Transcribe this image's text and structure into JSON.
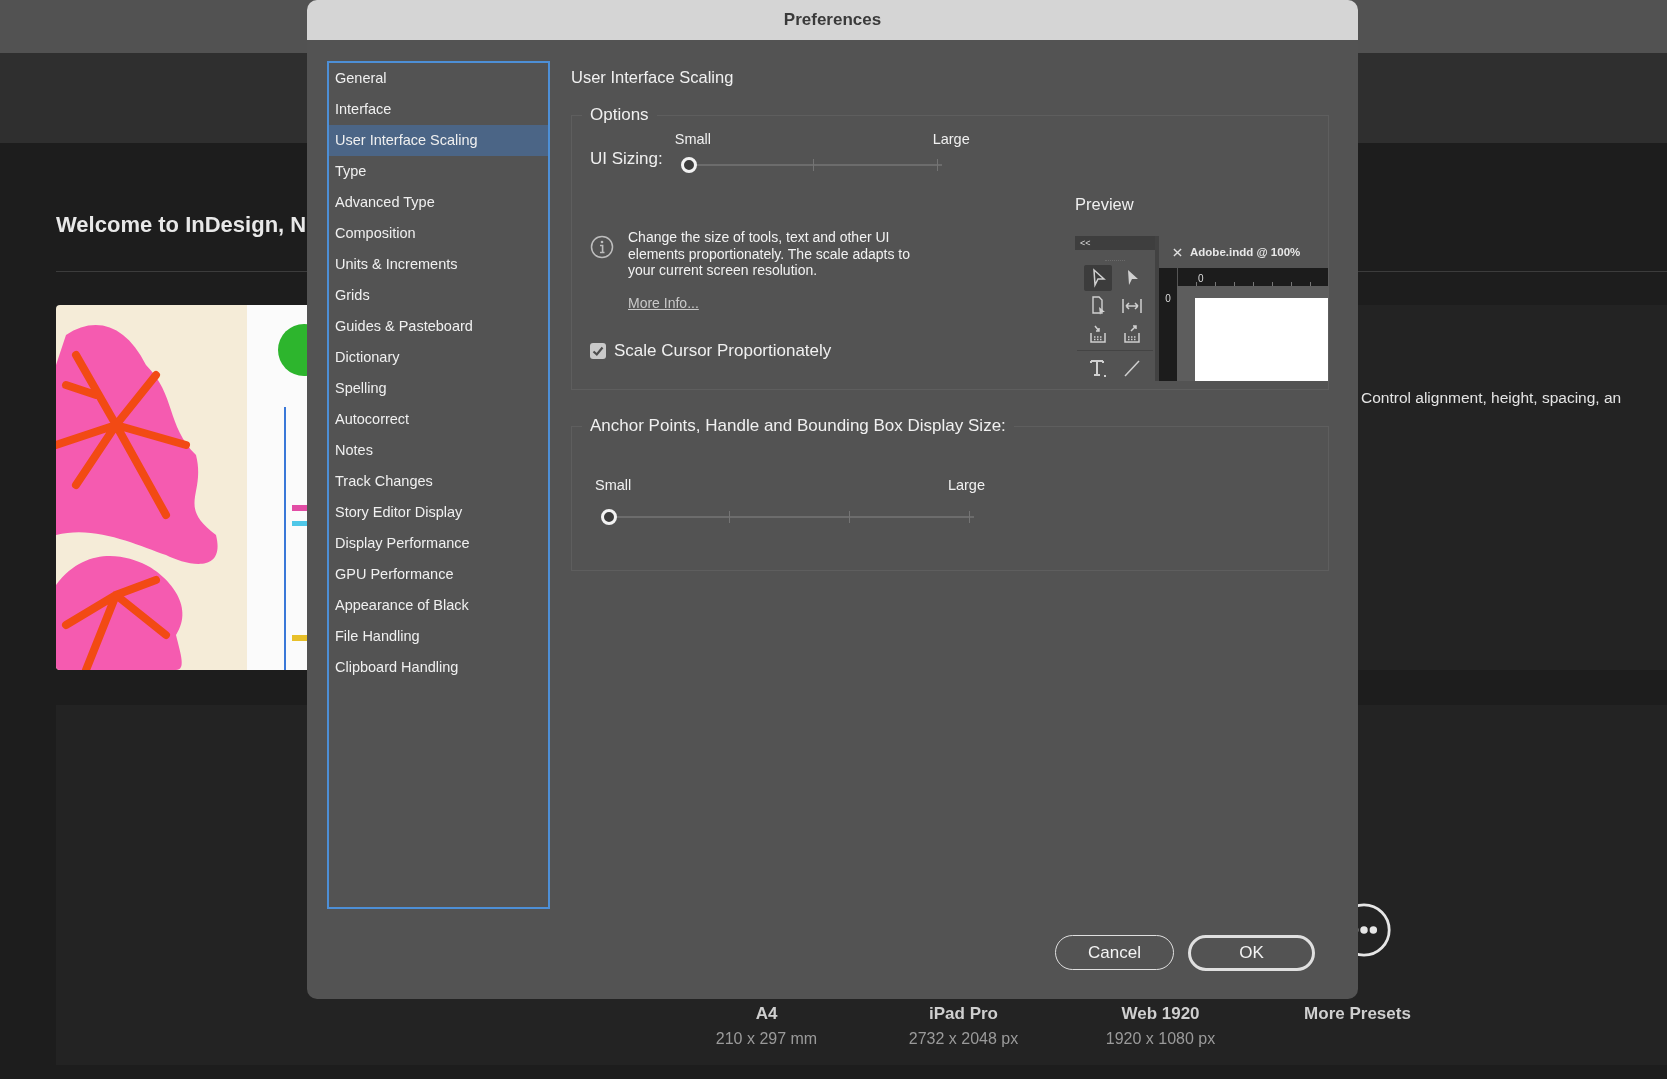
{
  "background": {
    "welcome": "Welcome to InDesign, N",
    "feature_text": "Control alignment, height, spacing, an",
    "presets": [
      {
        "name": "A4",
        "size": "210 x 297 mm"
      },
      {
        "name": "iPad Pro",
        "size": "2732 x 2048 px"
      },
      {
        "name": "Web 1920",
        "size": "1920 x 1080 px"
      },
      {
        "name": "More Presets",
        "kind": "more"
      }
    ]
  },
  "dialog": {
    "title": "Preferences",
    "categories": [
      {
        "label": "General",
        "selected": false
      },
      {
        "label": "Interface",
        "selected": false
      },
      {
        "label": "User Interface Scaling",
        "selected": true
      },
      {
        "label": "Type",
        "selected": false
      },
      {
        "label": "Advanced Type",
        "selected": false
      },
      {
        "label": "Composition",
        "selected": false
      },
      {
        "label": "Units & Increments",
        "selected": false
      },
      {
        "label": "Grids",
        "selected": false
      },
      {
        "label": "Guides & Pasteboard",
        "selected": false
      },
      {
        "label": "Dictionary",
        "selected": false
      },
      {
        "label": "Spelling",
        "selected": false
      },
      {
        "label": "Autocorrect",
        "selected": false
      },
      {
        "label": "Notes",
        "selected": false
      },
      {
        "label": "Track Changes",
        "selected": false
      },
      {
        "label": "Story Editor Display",
        "selected": false
      },
      {
        "label": "Display Performance",
        "selected": false
      },
      {
        "label": "GPU Performance",
        "selected": false
      },
      {
        "label": "Appearance of Black",
        "selected": false
      },
      {
        "label": "File Handling",
        "selected": false
      },
      {
        "label": "Clipboard Handling",
        "selected": false
      }
    ],
    "heading": "User Interface Scaling",
    "options": {
      "legend": "Options",
      "ui_sizing": {
        "label": "UI Sizing:",
        "min_label": "Small",
        "max_label": "Large",
        "level": 0
      },
      "info": "Change the size of tools, text and other UI elements proportionately. The scale adapts to your current screen resolution.",
      "more_info": "More Info...",
      "scale_cursor": {
        "label": "Scale Cursor Proportionately",
        "checked": true
      },
      "preview": {
        "label": "Preview",
        "collapse": "<<",
        "doc_tab": "Adobe.indd @ 100%",
        "ruler_h": "0",
        "ruler_v": "0"
      }
    },
    "anchor": {
      "legend": "Anchor Points, Handle and Bounding Box Display Size:",
      "min_label": "Small",
      "max_label": "Large",
      "level": 0
    },
    "buttons": [
      {
        "label": "Cancel",
        "default": false
      },
      {
        "label": "OK",
        "default": true
      }
    ]
  }
}
